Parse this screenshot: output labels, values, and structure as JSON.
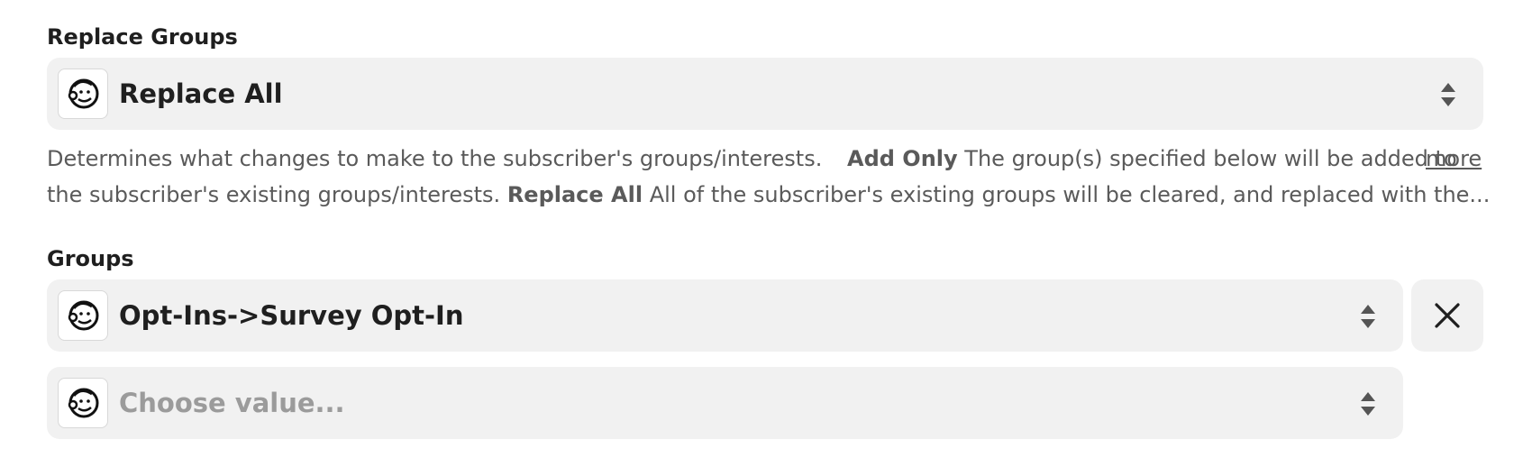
{
  "replace_groups": {
    "label": "Replace Groups",
    "selected_value": "Replace All",
    "app_icon": "mailchimp-icon",
    "control_icon": "updown-arrows-icon",
    "description": {
      "intro": "Determines what changes to make to the subscriber's groups/interests.",
      "option1_name": "Add Only",
      "option1_text_line1": "The group(s) specified below will be added to",
      "option1_text_line2": "the subscriber's existing groups/interests.",
      "option2_name": "Replace All",
      "option2_text": "All of the subscriber's existing groups will be cleared, and replaced with the..."
    },
    "more_link": "more"
  },
  "groups": {
    "label": "Groups",
    "items": [
      {
        "value": "Opt-Ins->Survey Opt-In",
        "app_icon": "mailchimp-icon"
      }
    ],
    "new_item": {
      "placeholder": "Choose value...",
      "app_icon": "mailchimp-icon"
    },
    "remove_icon": "close-icon"
  },
  "colors": {
    "field_bg": "#f1f1f1",
    "text": "#1f1f1f",
    "muted_text": "#5a5a5a",
    "placeholder": "#9b9b9b",
    "arrow": "#555555"
  }
}
